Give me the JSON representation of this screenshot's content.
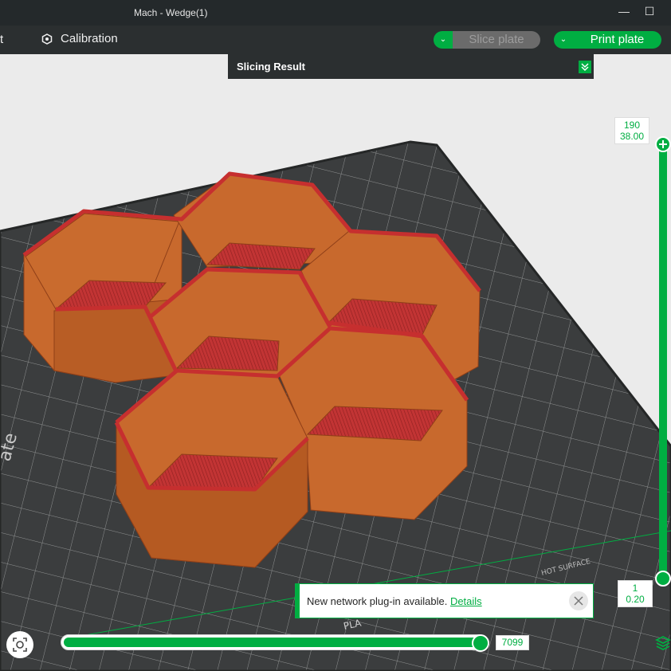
{
  "window": {
    "title": "Mach - Wedge(1)",
    "minimize_glyph": "—",
    "maximize_glyph": "☐"
  },
  "toolbar": {
    "partial_label": "t",
    "calibration_label": "Calibration",
    "slice_plate_label": "Slice plate",
    "print_plate_label": "Print plate",
    "dropdown_glyph": "⌄"
  },
  "slicing_panel": {
    "title": "Slicing Result"
  },
  "bed": {
    "side_text": "ate",
    "brand_label": "HOT SURFACE",
    "plate_label": "PLA"
  },
  "layer_slider": {
    "top_layer": "190",
    "top_height": "38.00",
    "bottom_layer": "1",
    "bottom_height": "0.20"
  },
  "move_slider": {
    "value": "7099",
    "progress": 1.0
  },
  "notification": {
    "message": "New network plug-in available.",
    "link": "Details"
  },
  "colors": {
    "accent": "#00ae42",
    "model_wall": "#c0652a",
    "model_top": "#c93636",
    "bed": "#3a3c3d",
    "background": "#ebebeb"
  },
  "icons": {
    "calibration": "calibration-icon",
    "camera": "camera-view-icon",
    "layers": "layers-icon",
    "close": "close-icon",
    "collapse": "collapse-icon"
  }
}
